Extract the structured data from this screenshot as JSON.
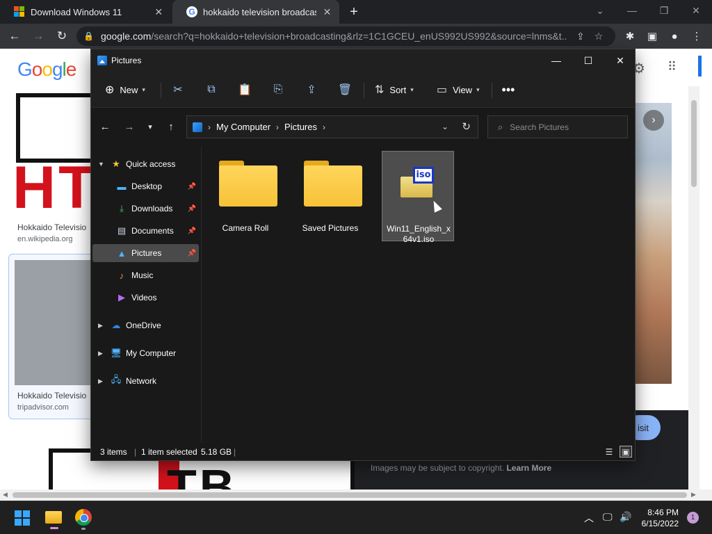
{
  "browser": {
    "tabs": [
      {
        "label": "Download Windows 11"
      },
      {
        "label": "hokkaido television broadcasting"
      }
    ],
    "url_host": "google.com",
    "url_path": "/search?q=hokkaido+television+broadcasting&rlz=1C1GCEU_enUS992US992&source=lnms&t..."
  },
  "webpage": {
    "results": [
      {
        "title": "Hokkaido Televisio",
        "source": "en.wikipedia.org"
      },
      {
        "title": "Hokkaido Televisio",
        "source": "tripadvisor.com"
      }
    ],
    "logo_letters": "HT",
    "bottom_letters": "TB",
    "visit_label": "isit",
    "copyright_text": "Images may be subject to copyright.",
    "copyright_link": "Learn More"
  },
  "explorer": {
    "title": "Pictures",
    "commands": {
      "new_label": "New",
      "sort_label": "Sort",
      "view_label": "View"
    },
    "breadcrumb": [
      "My Computer",
      "Pictures"
    ],
    "search_placeholder": "Search Pictures",
    "nav": {
      "quick_access": "Quick access",
      "desktop": "Desktop",
      "downloads": "Downloads",
      "documents": "Documents",
      "pictures": "Pictures",
      "music": "Music",
      "videos": "Videos",
      "onedrive": "OneDrive",
      "my_computer": "My Computer",
      "network": "Network"
    },
    "files": [
      {
        "name": "Camera Roll",
        "type": "folder"
      },
      {
        "name": "Saved Pictures",
        "type": "folder"
      },
      {
        "name": "Win11_English_x64v1.iso",
        "type": "iso"
      }
    ],
    "iso_badge": "iso",
    "status": {
      "items": "3 items",
      "selected": "1 item selected",
      "size": "5.18 GB"
    }
  },
  "taskbar": {
    "time": "8:46 PM",
    "date": "6/15/2022",
    "notification_count": "1"
  }
}
